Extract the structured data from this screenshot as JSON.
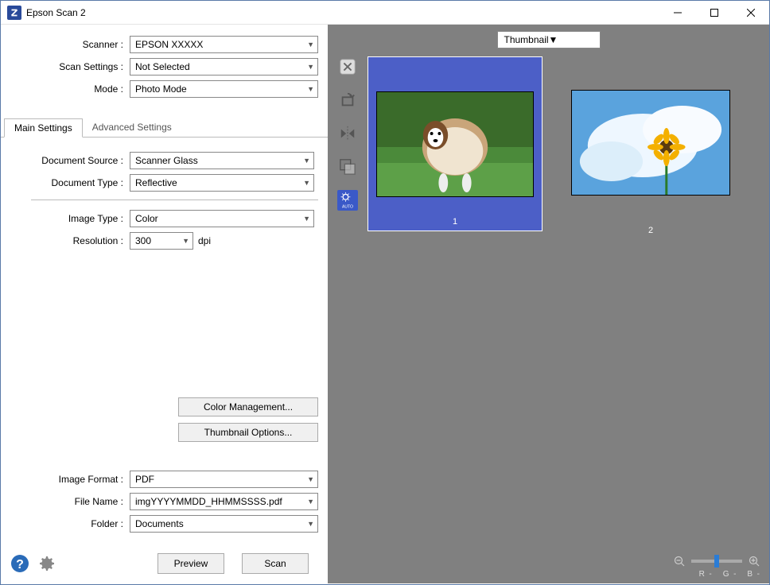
{
  "window": {
    "title": "Epson Scan 2"
  },
  "labels": {
    "scanner": "Scanner :",
    "scan_settings": "Scan Settings :",
    "mode": "Mode :",
    "document_source": "Document Source :",
    "document_type": "Document Type :",
    "image_type": "Image Type :",
    "resolution": "Resolution :",
    "image_format": "Image Format :",
    "file_name": "File Name :",
    "folder": "Folder :",
    "dpi": "dpi"
  },
  "values": {
    "scanner": "EPSON XXXXX",
    "scan_settings": "Not Selected",
    "mode": "Photo Mode",
    "document_source": "Scanner Glass",
    "document_type": "Reflective",
    "image_type": "Color",
    "resolution": "300",
    "image_format": "PDF",
    "file_name": "imgYYYYMMDD_HHMMSSSS.pdf",
    "folder": "Documents",
    "preview_view": "Thumbnail"
  },
  "tabs": {
    "main": "Main Settings",
    "advanced": "Advanced Settings"
  },
  "buttons": {
    "color_mgmt": "Color Management...",
    "thumb_opts": "Thumbnail Options...",
    "preview": "Preview",
    "scan": "Scan"
  },
  "thumbs": {
    "t1": "1",
    "t2": "2"
  },
  "tools": {
    "auto": "AUTO"
  },
  "rgb": {
    "r": "R",
    "g": "G",
    "b": "B",
    "dash": "-"
  }
}
